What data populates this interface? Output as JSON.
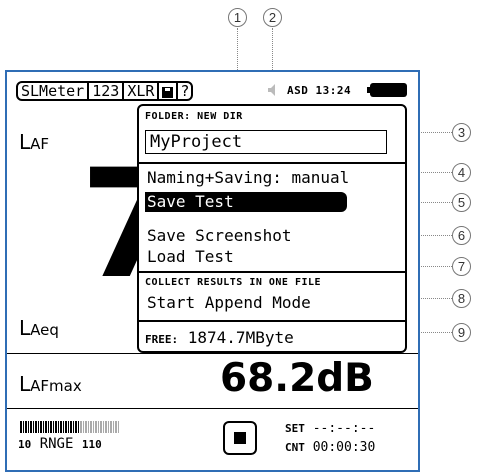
{
  "callouts": [
    "1",
    "2",
    "3",
    "4",
    "5",
    "6",
    "7",
    "8",
    "9"
  ],
  "tabs": [
    "SLMeter",
    "123",
    "XLR",
    "?"
  ],
  "status": {
    "text": "ASD 13:24"
  },
  "labels": {
    "laf": {
      "main": "L",
      "sub": "AF"
    },
    "laeq": {
      "main": "L",
      "sub": "Aeq"
    },
    "lafmax": {
      "main": "L",
      "sub": "AFmax"
    }
  },
  "big_digit": "7",
  "lafmax_value": "68.2dB",
  "menu": {
    "folder_header": "FOLDER: NEW DIR",
    "folder_value": "MyProject",
    "naming": "Naming+Saving: manual",
    "save_test": "Save Test",
    "save_screenshot": "Save Screenshot",
    "load_test": "Load Test",
    "collect_header": "COLLECT RESULTS IN ONE FILE",
    "append": "Start Append Mode",
    "free_label": "FREE:",
    "free_value": "1874.7MByte"
  },
  "bottom": {
    "range_lo": "10",
    "range_text": "RNGE",
    "range_hi": "110",
    "set_label": "SET",
    "set_value": "--:--:--",
    "cnt_label": "CNT",
    "cnt_value": "00:00:30"
  },
  "colors": {
    "frame": "#2f6db5",
    "callout": "#777777"
  },
  "icons": {
    "save": "disk-icon",
    "speaker": "speaker-icon",
    "battery": "battery-icon",
    "stop": "stop-icon"
  }
}
